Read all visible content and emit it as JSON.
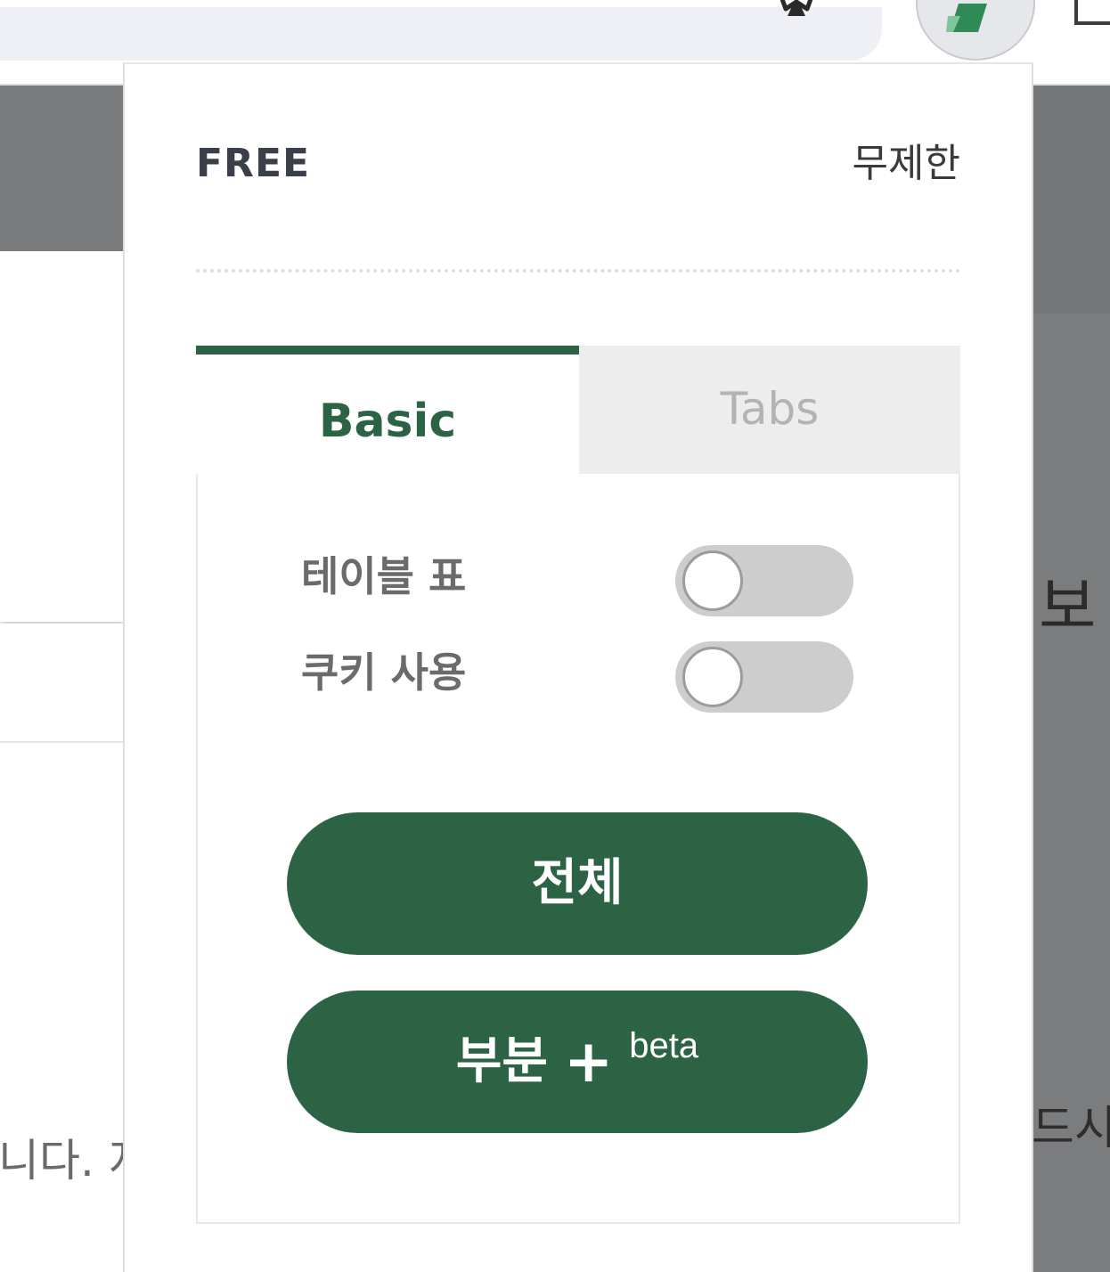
{
  "browser": {
    "star_icon": "star-outline-icon",
    "extension_icon": "extension-logo-icon"
  },
  "background_page": {
    "left_text": "니다. 지",
    "right_text_1": "보",
    "right_text_2": "드시트"
  },
  "popup": {
    "plan": {
      "label": "FREE",
      "value": "무제한"
    },
    "tabs": [
      {
        "label": "Basic",
        "active": true
      },
      {
        "label": "Tabs",
        "active": false
      }
    ],
    "settings": [
      {
        "label": "테이블 표",
        "enabled": false
      },
      {
        "label": "쿠키 사용",
        "enabled": false
      }
    ],
    "buttons": {
      "full": "전체",
      "partial": "부분",
      "partial_plus": "+",
      "partial_badge": "beta"
    }
  },
  "colors": {
    "accent": "#2c6345",
    "toggle_off": "#cdcdcd",
    "inactive_tab": "#ededed"
  }
}
